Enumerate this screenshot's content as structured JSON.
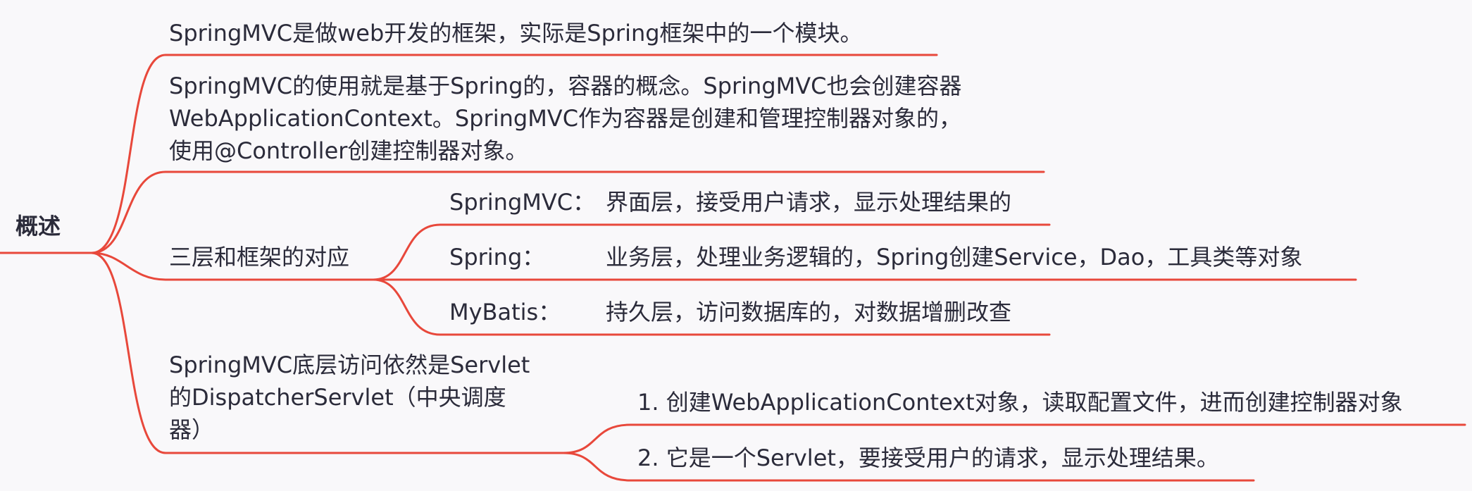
{
  "root": {
    "label": "概述"
  },
  "branches": [
    {
      "text": "SpringMVC是做web开发的框架，实际是Spring框架中的一个模块。"
    },
    {
      "lines": [
        "SpringMVC的使用就是基于Spring的，容器的概念。SpringMVC也会创建容器",
        "WebApplicationContext。SpringMVC作为容器是创建和管理控制器对象的，",
        "使用@Controller创建控制器对象。"
      ]
    },
    {
      "text": "三层和框架的对应",
      "children": [
        {
          "name": "SpringMVC：",
          "desc": "界面层，接受用户请求，显示处理结果的"
        },
        {
          "name": "Spring：",
          "desc": "业务层，处理业务逻辑的，Spring创建Service，Dao，工具类等对象"
        },
        {
          "name": "MyBatis：",
          "desc": "持久层，访问数据库的，对数据增删改查"
        }
      ]
    },
    {
      "lines": [
        "SpringMVC底层访问依然是Servlet",
        "的DispatcherServlet（中央调度",
        "器）"
      ],
      "children": [
        {
          "text": "1. 创建WebApplicationContext对象，读取配置文件，进而创建控制器对象"
        },
        {
          "text": "2. 它是一个Servlet，要接受用户的请求，显示处理结果。"
        }
      ]
    }
  ],
  "colors": {
    "edge": "#e8483b",
    "text": "#2b2b3a",
    "background": "#f9f8fa"
  }
}
